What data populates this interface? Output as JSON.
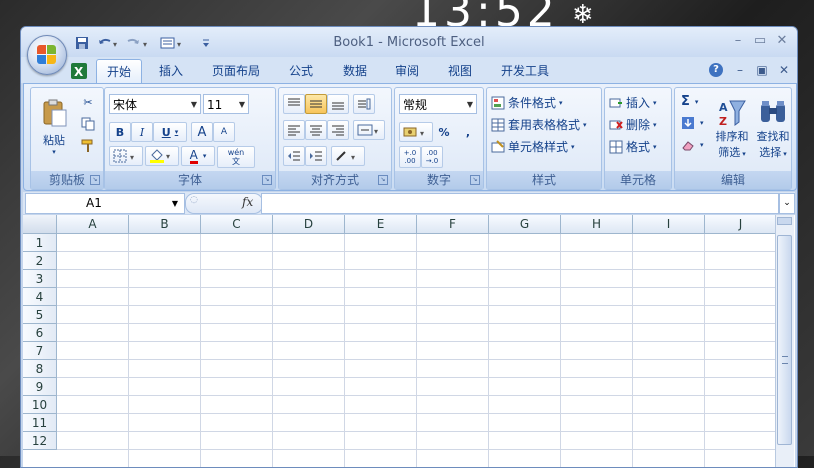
{
  "desktop": {
    "clock": "13:52"
  },
  "window": {
    "title": "Book1 - Microsoft Excel"
  },
  "tabs": [
    {
      "label": "开始",
      "active": true
    },
    {
      "label": "插入"
    },
    {
      "label": "页面布局"
    },
    {
      "label": "公式"
    },
    {
      "label": "数据"
    },
    {
      "label": "审阅"
    },
    {
      "label": "视图"
    },
    {
      "label": "开发工具"
    }
  ],
  "clipboard": {
    "label": "剪贴板",
    "paste": "粘贴"
  },
  "font": {
    "label": "字体",
    "name": "宋体",
    "size": "11",
    "bold": "B",
    "italic": "I",
    "underline": "U",
    "grow": "A",
    "shrink": "A",
    "fontcolor": "A",
    "phonetic": "wén\n文"
  },
  "alignment": {
    "label": "对齐方式"
  },
  "number": {
    "label": "数字",
    "format": "常规",
    "percent": "%",
    "comma": ",",
    "inc": "+.0\n.00",
    "dec": ".00\n→.0"
  },
  "styles": {
    "label": "样式",
    "conditional": "条件格式",
    "table": "套用表格格式",
    "cell": "单元格样式"
  },
  "cells": {
    "label": "单元格",
    "insert": "插入",
    "delete": "删除",
    "format": "格式"
  },
  "editing": {
    "label": "编辑",
    "sum": "Σ",
    "sort": "排序和",
    "sort2": "筛选",
    "find": "查找和",
    "find2": "选择"
  },
  "formula_bar": {
    "namebox": "A1",
    "fx": "fx"
  },
  "sheet": {
    "columns": [
      "A",
      "B",
      "C",
      "D",
      "E",
      "F",
      "G",
      "H",
      "I",
      "J"
    ],
    "rows": [
      "1",
      "2",
      "3",
      "4",
      "5",
      "6",
      "7",
      "8",
      "9",
      "10",
      "11",
      "12"
    ]
  },
  "colors": {
    "accent": "#15428b",
    "ribbon": "#dae6f6",
    "gridline": "#d0d7e5",
    "selected_button": "#f7c45a"
  }
}
